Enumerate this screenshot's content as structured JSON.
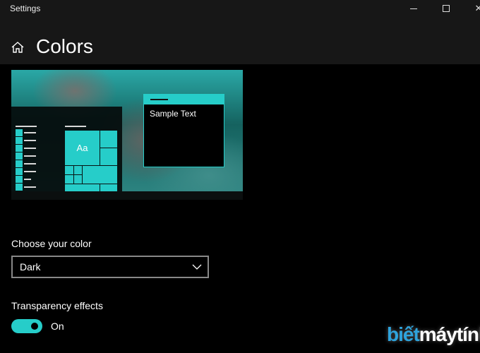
{
  "window": {
    "title": "Settings",
    "minimize_icon": "minimize-icon",
    "maximize_icon": "maximize-icon",
    "close_icon": "close-icon"
  },
  "header": {
    "title": "Colors",
    "home_icon": "home-icon"
  },
  "preview": {
    "sample_text": "Sample Text",
    "tile_label": "Aa",
    "accent": "#26cdc9"
  },
  "color_choice": {
    "label": "Choose your color",
    "value": "Dark"
  },
  "transparency": {
    "label": "Transparency effects",
    "state": "On",
    "enabled": true
  },
  "watermark": {
    "part1": "biết",
    "part2": "máytính",
    "color1": "#2ea3dc"
  }
}
